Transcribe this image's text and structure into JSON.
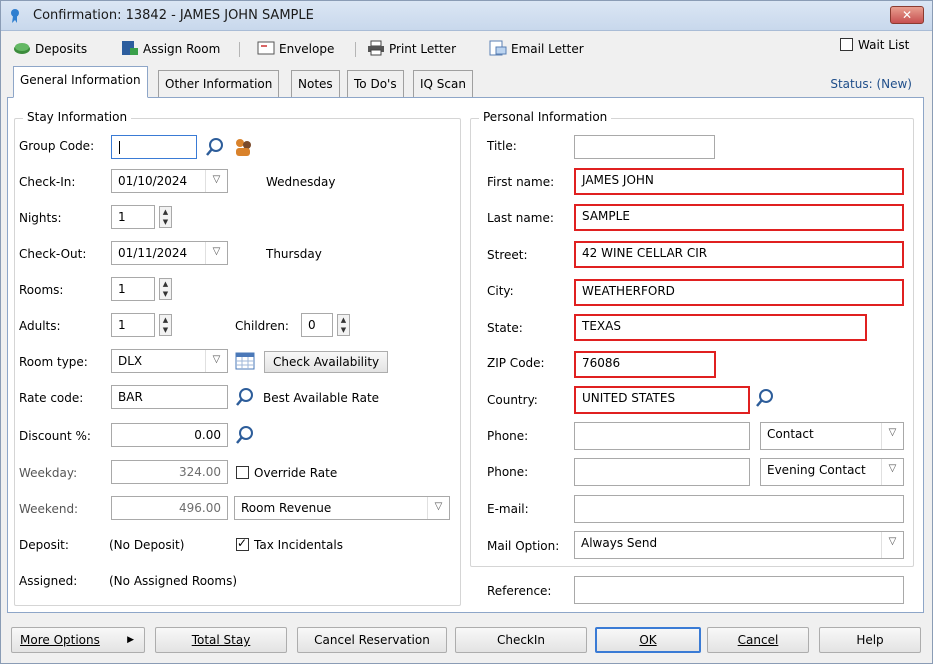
{
  "window": {
    "title": "Confirmation: 13842 - JAMES JOHN SAMPLE",
    "close_label": "✕"
  },
  "toolbar": {
    "deposits": "Deposits",
    "assign_room": "Assign Room",
    "envelope": "Envelope",
    "print_letter": "Print Letter",
    "email_letter": "Email Letter",
    "wait_list": "Wait List"
  },
  "tabs": [
    {
      "label": "General Information"
    },
    {
      "label": "Other Information"
    },
    {
      "label": "Notes"
    },
    {
      "label": "To Do's"
    },
    {
      "label": "IQ Scan"
    }
  ],
  "status": "Status: (New)",
  "stay": {
    "title": "Stay Information",
    "group_code_label": "Group Code:",
    "group_code_value": "",
    "checkin_label": "Check-In:",
    "checkin_value": "01/10/2024",
    "checkin_day": "Wednesday",
    "nights_label": "Nights:",
    "nights_value": "1",
    "checkout_label": "Check-Out:",
    "checkout_value": "01/11/2024",
    "checkout_day": "Thursday",
    "rooms_label": "Rooms:",
    "rooms_value": "1",
    "adults_label": "Adults:",
    "adults_value": "1",
    "children_label": "Children:",
    "children_value": "0",
    "room_type_label": "Room type:",
    "room_type_value": "DLX",
    "check_availability": "Check Availability",
    "rate_code_label": "Rate code:",
    "rate_code_value": "BAR",
    "rate_code_desc": "Best Available Rate",
    "discount_label": "Discount %:",
    "discount_value": "0.00",
    "weekday_label": "Weekday:",
    "weekday_value": "324.00",
    "override_rate": "Override Rate",
    "weekend_label": "Weekend:",
    "weekend_value": "496.00",
    "revenue_value": "Room Revenue",
    "deposit_label": "Deposit:",
    "deposit_value": "(No Deposit)",
    "tax_incidentals": "Tax Incidentals",
    "assigned_label": "Assigned:",
    "assigned_value": "(No Assigned Rooms)"
  },
  "personal": {
    "title": "Personal Information",
    "title_label": "Title:",
    "title_value": "",
    "first_label": "First name:",
    "first_value": "JAMES JOHN",
    "last_label": "Last name:",
    "last_value": "SAMPLE",
    "street_label": "Street:",
    "street_value": "42 WINE CELLAR CIR",
    "city_label": "City:",
    "city_value": "WEATHERFORD",
    "state_label": "State:",
    "state_value": "TEXAS",
    "zip_label": "ZIP Code:",
    "zip_value": "76086",
    "country_label": "Country:",
    "country_value": "UNITED STATES",
    "phone1_label": "Phone:",
    "phone1_value": "",
    "phone1_type": "Contact",
    "phone2_label": "Phone:",
    "phone2_value": "",
    "phone2_type": "Evening Contact",
    "email_label": "E-mail:",
    "email_value": "",
    "mail_label": "Mail Option:",
    "mail_value": "Always Send",
    "reference_label": "Reference:",
    "reference_value": ""
  },
  "buttons": {
    "more_options": "More Options",
    "total_stay": "Total Stay",
    "cancel_reservation": "Cancel Reservation",
    "checkin": "CheckIn",
    "ok": "OK",
    "cancel": "Cancel",
    "help": "Help"
  },
  "colors": {
    "required_border": "#e02020",
    "accent": "#3a7bd5",
    "status": "#1f4e8a"
  }
}
